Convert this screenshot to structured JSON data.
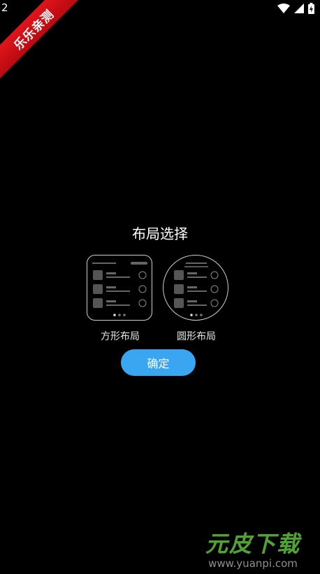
{
  "status_bar": {
    "time": "2",
    "icons": [
      "wifi-icon",
      "signal-icon",
      "battery-charging-icon"
    ]
  },
  "ribbon": {
    "text": "乐乐亲测"
  },
  "dialog": {
    "title": "布局选择",
    "options": [
      {
        "label": "方形布局",
        "shape": "square"
      },
      {
        "label": "圆形布局",
        "shape": "round"
      }
    ],
    "confirm_label": "确定"
  },
  "watermark": {
    "logo": "元皮下载",
    "url": "www.yuanpi.com"
  },
  "colors": {
    "background": "#000000",
    "accent": "#3aa6f2",
    "ribbon": "#d0121a"
  }
}
